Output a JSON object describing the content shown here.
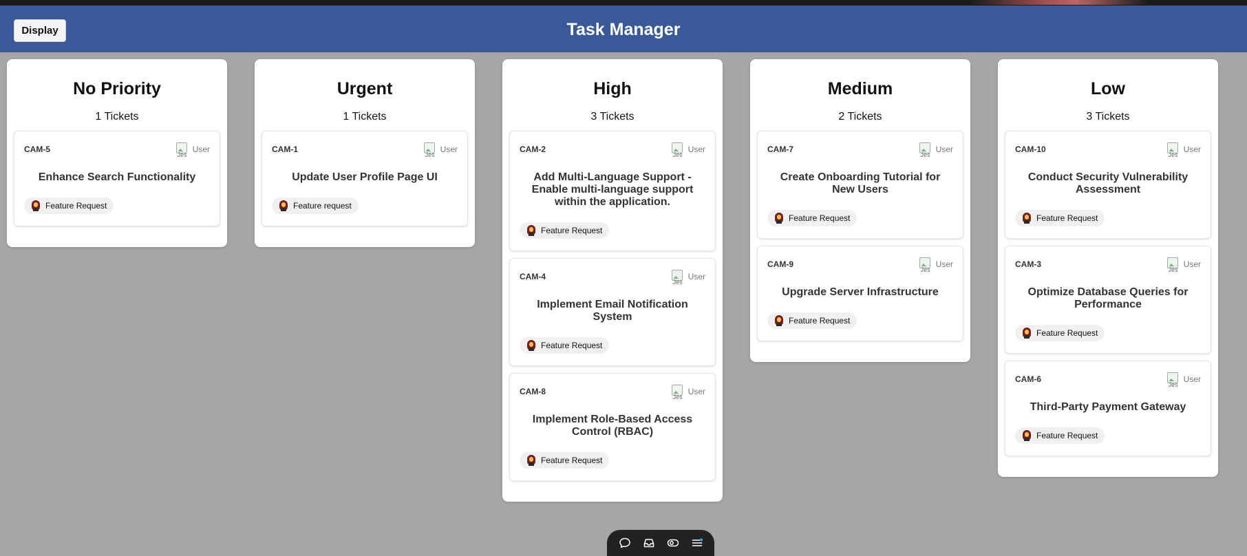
{
  "header": {
    "title": "Task Manager",
    "display_label": "Display"
  },
  "columns": [
    {
      "title": "No Priority",
      "count": "1 Tickets",
      "cards": [
        {
          "id": "CAM-5",
          "user": "User",
          "avatar_alt": "Jes",
          "title": "Enhance Search Functionality",
          "tag": "Feature Request"
        }
      ]
    },
    {
      "title": "Urgent",
      "count": "1 Tickets",
      "cards": [
        {
          "id": "CAM-1",
          "user": "User",
          "avatar_alt": "Jes",
          "title": "Update User Profile Page UI",
          "tag": "Feature request"
        }
      ]
    },
    {
      "title": "High",
      "count": "3 Tickets",
      "cards": [
        {
          "id": "CAM-2",
          "user": "User",
          "avatar_alt": "Jes",
          "title": "Add Multi-Language Support - Enable multi-language support within the application.",
          "tag": "Feature Request"
        },
        {
          "id": "CAM-4",
          "user": "User",
          "avatar_alt": "Jes",
          "title": "Implement Email Notification System",
          "tag": "Feature Request"
        },
        {
          "id": "CAM-8",
          "user": "User",
          "avatar_alt": "Jes",
          "title": "Implement Role-Based Access Control (RBAC)",
          "tag": "Feature Request"
        }
      ]
    },
    {
      "title": "Medium",
      "count": "2 Tickets",
      "cards": [
        {
          "id": "CAM-7",
          "user": "User",
          "avatar_alt": "Jes",
          "title": "Create Onboarding Tutorial for New Users",
          "tag": "Feature Request"
        },
        {
          "id": "CAM-9",
          "user": "User",
          "avatar_alt": "Jes",
          "title": "Upgrade Server Infrastructure",
          "tag": "Feature Request"
        }
      ]
    },
    {
      "title": "Low",
      "count": "3 Tickets",
      "cards": [
        {
          "id": "CAM-10",
          "user": "User",
          "avatar_alt": "Jes",
          "title": "Conduct Security Vulnerability Assessment",
          "tag": "Feature Request"
        },
        {
          "id": "CAM-3",
          "user": "User",
          "avatar_alt": "Jes",
          "title": "Optimize Database Queries for Performance",
          "tag": "Feature Request"
        },
        {
          "id": "CAM-6",
          "user": "User",
          "avatar_alt": "Jes",
          "title": "Third-Party Payment Gateway",
          "tag": "Feature Request"
        }
      ]
    }
  ],
  "dock": {
    "icons": [
      "chat-bubble-icon",
      "inbox-icon",
      "eye-toggle-icon",
      "menu-icon"
    ]
  },
  "colors": {
    "header_bg": "#3a5998",
    "page_bg": "#a6a6a6",
    "card_bg": "#ffffff",
    "tag_bg": "#f0f0f0",
    "dock_bg": "#222222"
  }
}
